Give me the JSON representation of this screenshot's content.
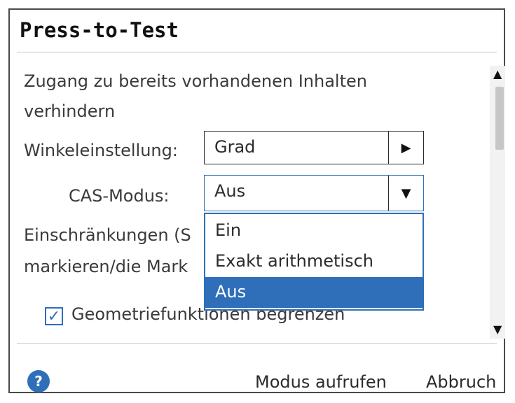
{
  "dialog": {
    "title": "Press-to-Test",
    "section_text_line1": "Zugang zu bereits vorhandenen Inhalten",
    "section_text_line2": "verhindern",
    "angle_label": "Winkeleinstellung:",
    "angle_value": "Grad",
    "cas_label": "CAS-Modus:",
    "cas_value": "Aus",
    "restrictions_line1": "Einschränkungen (S",
    "restrictions_line2": "markieren/die Mark",
    "geometry_label": "Geometriefunktionen begrenzen",
    "dropdown_options": [
      "Ein",
      "Exakt arithmetisch",
      "Aus"
    ],
    "dropdown_selected": "Aus",
    "footer": {
      "help_symbol": "?",
      "enter_mode": "Modus aufrufen",
      "cancel": "Abbruch"
    }
  },
  "colors": {
    "accent": "#2f6fb9",
    "border": "#4a4a4a"
  },
  "icons": {
    "help": "question-circle-icon",
    "arrow_right": "triangle-right-icon",
    "arrow_down": "triangle-down-icon",
    "check": "checkmark-icon",
    "scroll_up": "triangle-up-icon",
    "scroll_down": "triangle-down-icon"
  }
}
